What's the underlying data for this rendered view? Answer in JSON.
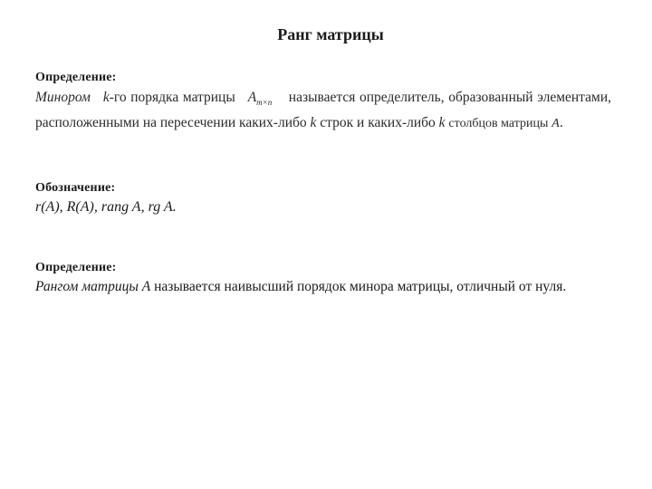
{
  "title": "Ранг матрицы",
  "section1": {
    "heading": "Определение:",
    "term": "Минором",
    "k1": "k",
    "text1": "-го порядка матрицы",
    "matrix": "A",
    "matrix_sub": "m×n",
    "text2": "называется определитель, образованный элементами, расположенными на пересечении каких-либо",
    "k2": "k",
    "text3": "строк и каких-либо",
    "k3": "k",
    "text4": "столбцов матрицы",
    "matrix2": "A",
    "end": "."
  },
  "section2": {
    "heading": "Обозначение:",
    "notation": "r(A), R(A), rang A, rg A."
  },
  "section3": {
    "heading": "Определение:",
    "term": "Рангом матрицы A",
    "text": "называется наивысший порядок минора матрицы, отличный от нуля."
  }
}
